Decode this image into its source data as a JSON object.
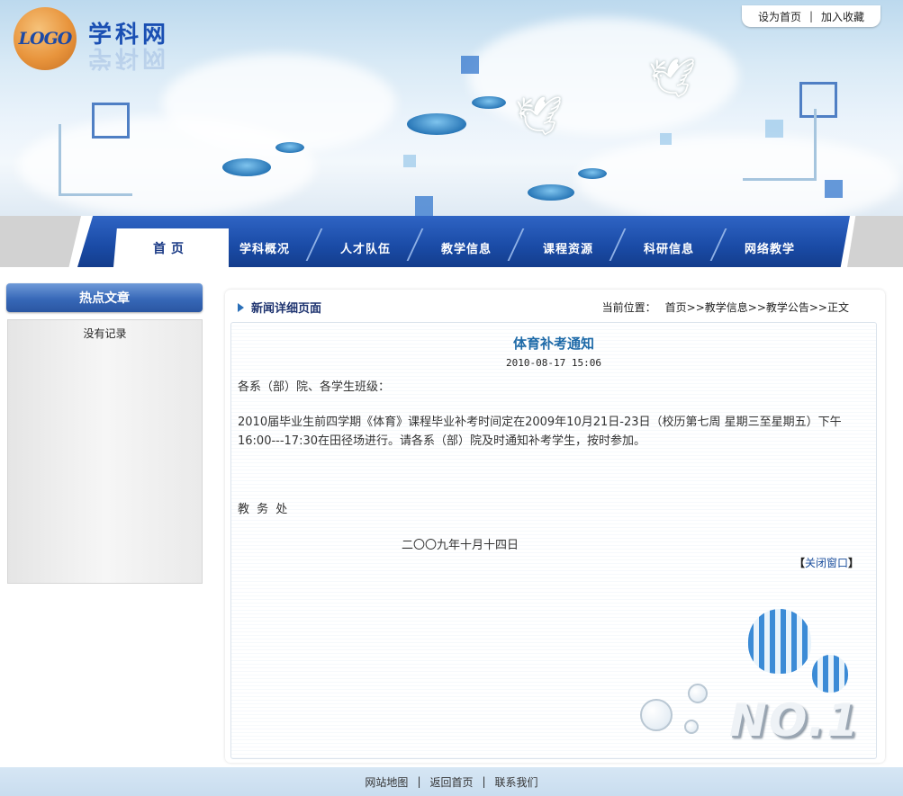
{
  "header": {
    "logo_text": "LOGO",
    "site_name": "学科网",
    "links": [
      "设为首页",
      "加入收藏"
    ],
    "separator": "|"
  },
  "nav": {
    "items": [
      "首页",
      "学科概况",
      "人才队伍",
      "教学信息",
      "课程资源",
      "科研信息",
      "网络教学"
    ],
    "active_index": 0
  },
  "sidebar": {
    "title": "热点文章",
    "empty_text": "没有记录"
  },
  "main": {
    "section_title": "新闻详细页面",
    "breadcrumb_label": "当前位置：",
    "breadcrumb_path": "首页>>教学信息>>教学公告>>正文"
  },
  "article": {
    "title": "体育补考通知",
    "date": "2010-08-17 15:06",
    "salutation": "各系（部）院、各学生班级：",
    "body": "2010届毕业生前四学期《体育》课程毕业补考时间定在2009年10月21日-23日（校历第七周 星期三至星期五）下午16:00---17:30在田径场进行。请各系（部）院及时通知补考学生，按时参加。",
    "signature": "教 务 处",
    "sign_date": "二〇〇九年十月十四日",
    "close_bracket_left": "【",
    "close_text": "关闭窗口",
    "close_bracket_right": "】",
    "decor_text": "NO.1"
  },
  "footer": {
    "links": [
      "网站地图",
      "返回首页",
      "联系我们"
    ],
    "separator": "|"
  }
}
